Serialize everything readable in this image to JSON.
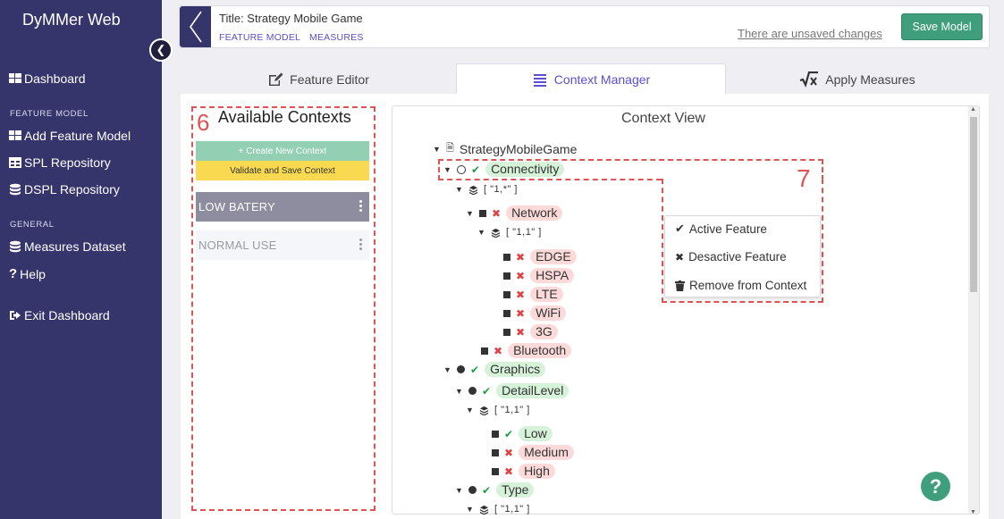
{
  "sidebar": {
    "brand": "DyMMer Web",
    "dashboard": "Dashboard",
    "feature_model_heading": "FEATURE MODEL",
    "add_feature_model": "Add Feature Model",
    "spl_repository": "SPL Repository",
    "dspl_repository": "DSPL Repository",
    "general_heading": "GENERAL",
    "measures_dataset": "Measures Dataset",
    "help": "Help",
    "exit": "Exit Dashboard"
  },
  "topbar": {
    "title": "Title: Strategy Mobile Game",
    "crumb_feature_model": "FEATURE MODEL",
    "crumb_measures": "MEASURES",
    "unsaved": "There are unsaved changes",
    "save_label": "Save Model"
  },
  "tabs": {
    "feature_editor": "Feature Editor",
    "context_manager": "Context Manager",
    "apply_measures": "Apply Measures"
  },
  "contexts": {
    "annotation": "6",
    "title": "Available Contexts",
    "create_label": "+ Create New Context",
    "validate_label": "Validate and Save Context",
    "items": [
      "LOW BATERY",
      "NORMAL USE"
    ]
  },
  "context_view": {
    "title": "Context View",
    "root": "StrategyMobileGame",
    "connectivity": "Connectivity",
    "card_1_star": "[ \"1,*\" ]",
    "network": "Network",
    "card_1_1": "[ \"1,1\" ]",
    "edge": "EDGE",
    "hspa": "HSPA",
    "lte": "LTE",
    "wifi": "WiFi",
    "g3": "3G",
    "bluetooth": "Bluetooth",
    "graphics": "Graphics",
    "detail_level": "DetailLevel",
    "low": "Low",
    "medium": "Medium",
    "high": "High",
    "type": "Type"
  },
  "menu": {
    "annotation": "7",
    "active": "Active Feature",
    "desactive": "Desactive Feature",
    "remove": "Remove from Context"
  },
  "colors": {
    "sidebar": "#35346b",
    "accent": "#5a4fcf",
    "save": "#3f9e7c",
    "annotation": "#e05353",
    "active_pill": "#d6f2d9",
    "inactive_pill": "#fcdada"
  }
}
